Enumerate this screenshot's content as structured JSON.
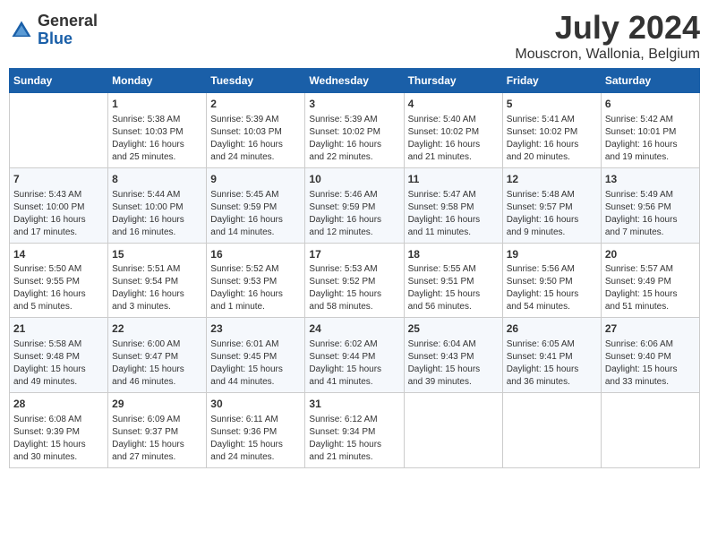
{
  "header": {
    "logo_general": "General",
    "logo_blue": "Blue",
    "title": "July 2024",
    "subtitle": "Mouscron, Wallonia, Belgium"
  },
  "columns": [
    "Sunday",
    "Monday",
    "Tuesday",
    "Wednesday",
    "Thursday",
    "Friday",
    "Saturday"
  ],
  "weeks": [
    [
      {
        "day": "",
        "content": ""
      },
      {
        "day": "1",
        "content": "Sunrise: 5:38 AM\nSunset: 10:03 PM\nDaylight: 16 hours\nand 25 minutes."
      },
      {
        "day": "2",
        "content": "Sunrise: 5:39 AM\nSunset: 10:03 PM\nDaylight: 16 hours\nand 24 minutes."
      },
      {
        "day": "3",
        "content": "Sunrise: 5:39 AM\nSunset: 10:02 PM\nDaylight: 16 hours\nand 22 minutes."
      },
      {
        "day": "4",
        "content": "Sunrise: 5:40 AM\nSunset: 10:02 PM\nDaylight: 16 hours\nand 21 minutes."
      },
      {
        "day": "5",
        "content": "Sunrise: 5:41 AM\nSunset: 10:02 PM\nDaylight: 16 hours\nand 20 minutes."
      },
      {
        "day": "6",
        "content": "Sunrise: 5:42 AM\nSunset: 10:01 PM\nDaylight: 16 hours\nand 19 minutes."
      }
    ],
    [
      {
        "day": "7",
        "content": "Sunrise: 5:43 AM\nSunset: 10:00 PM\nDaylight: 16 hours\nand 17 minutes."
      },
      {
        "day": "8",
        "content": "Sunrise: 5:44 AM\nSunset: 10:00 PM\nDaylight: 16 hours\nand 16 minutes."
      },
      {
        "day": "9",
        "content": "Sunrise: 5:45 AM\nSunset: 9:59 PM\nDaylight: 16 hours\nand 14 minutes."
      },
      {
        "day": "10",
        "content": "Sunrise: 5:46 AM\nSunset: 9:59 PM\nDaylight: 16 hours\nand 12 minutes."
      },
      {
        "day": "11",
        "content": "Sunrise: 5:47 AM\nSunset: 9:58 PM\nDaylight: 16 hours\nand 11 minutes."
      },
      {
        "day": "12",
        "content": "Sunrise: 5:48 AM\nSunset: 9:57 PM\nDaylight: 16 hours\nand 9 minutes."
      },
      {
        "day": "13",
        "content": "Sunrise: 5:49 AM\nSunset: 9:56 PM\nDaylight: 16 hours\nand 7 minutes."
      }
    ],
    [
      {
        "day": "14",
        "content": "Sunrise: 5:50 AM\nSunset: 9:55 PM\nDaylight: 16 hours\nand 5 minutes."
      },
      {
        "day": "15",
        "content": "Sunrise: 5:51 AM\nSunset: 9:54 PM\nDaylight: 16 hours\nand 3 minutes."
      },
      {
        "day": "16",
        "content": "Sunrise: 5:52 AM\nSunset: 9:53 PM\nDaylight: 16 hours\nand 1 minute."
      },
      {
        "day": "17",
        "content": "Sunrise: 5:53 AM\nSunset: 9:52 PM\nDaylight: 15 hours\nand 58 minutes."
      },
      {
        "day": "18",
        "content": "Sunrise: 5:55 AM\nSunset: 9:51 PM\nDaylight: 15 hours\nand 56 minutes."
      },
      {
        "day": "19",
        "content": "Sunrise: 5:56 AM\nSunset: 9:50 PM\nDaylight: 15 hours\nand 54 minutes."
      },
      {
        "day": "20",
        "content": "Sunrise: 5:57 AM\nSunset: 9:49 PM\nDaylight: 15 hours\nand 51 minutes."
      }
    ],
    [
      {
        "day": "21",
        "content": "Sunrise: 5:58 AM\nSunset: 9:48 PM\nDaylight: 15 hours\nand 49 minutes."
      },
      {
        "day": "22",
        "content": "Sunrise: 6:00 AM\nSunset: 9:47 PM\nDaylight: 15 hours\nand 46 minutes."
      },
      {
        "day": "23",
        "content": "Sunrise: 6:01 AM\nSunset: 9:45 PM\nDaylight: 15 hours\nand 44 minutes."
      },
      {
        "day": "24",
        "content": "Sunrise: 6:02 AM\nSunset: 9:44 PM\nDaylight: 15 hours\nand 41 minutes."
      },
      {
        "day": "25",
        "content": "Sunrise: 6:04 AM\nSunset: 9:43 PM\nDaylight: 15 hours\nand 39 minutes."
      },
      {
        "day": "26",
        "content": "Sunrise: 6:05 AM\nSunset: 9:41 PM\nDaylight: 15 hours\nand 36 minutes."
      },
      {
        "day": "27",
        "content": "Sunrise: 6:06 AM\nSunset: 9:40 PM\nDaylight: 15 hours\nand 33 minutes."
      }
    ],
    [
      {
        "day": "28",
        "content": "Sunrise: 6:08 AM\nSunset: 9:39 PM\nDaylight: 15 hours\nand 30 minutes."
      },
      {
        "day": "29",
        "content": "Sunrise: 6:09 AM\nSunset: 9:37 PM\nDaylight: 15 hours\nand 27 minutes."
      },
      {
        "day": "30",
        "content": "Sunrise: 6:11 AM\nSunset: 9:36 PM\nDaylight: 15 hours\nand 24 minutes."
      },
      {
        "day": "31",
        "content": "Sunrise: 6:12 AM\nSunset: 9:34 PM\nDaylight: 15 hours\nand 21 minutes."
      },
      {
        "day": "",
        "content": ""
      },
      {
        "day": "",
        "content": ""
      },
      {
        "day": "",
        "content": ""
      }
    ]
  ]
}
